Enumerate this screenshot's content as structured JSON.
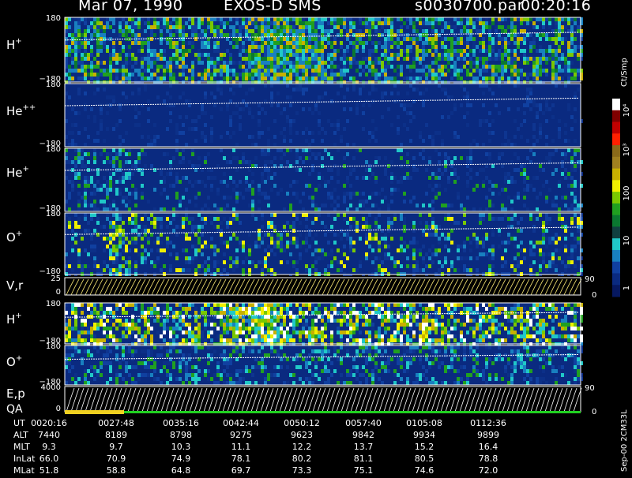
{
  "header": {
    "date": "Mar 07, 1990",
    "instrument": "EXOS-D SMS",
    "file": "s0030700.par",
    "time": "00:20:16"
  },
  "side_labels": {
    "units": "Ct/Smp",
    "version": "Sep-00 2CM33L"
  },
  "panels": [
    {
      "id": "h-plus-1",
      "label": "H",
      "sup": "+",
      "ticks": [
        "180",
        "−180"
      ],
      "colorscale": "h1"
    },
    {
      "id": "he-plus-plus",
      "label": "He",
      "sup": "++",
      "ticks": [
        "180",
        "−180"
      ],
      "colorscale": "hepp"
    },
    {
      "id": "he-plus",
      "label": "He",
      "sup": "+",
      "ticks": [
        "180",
        "−180"
      ],
      "colorscale": "hep"
    },
    {
      "id": "o-plus-1",
      "label": "O",
      "sup": "+",
      "ticks": [
        "180",
        "−180"
      ],
      "colorscale": "o1"
    },
    {
      "id": "vr",
      "label": "V,r",
      "sup": "",
      "ticks": [
        "25",
        "0"
      ],
      "right_ticks": [
        "90",
        "0"
      ]
    },
    {
      "id": "h-plus-2",
      "label": "H",
      "sup": "+",
      "ticks": [
        "180",
        "−180"
      ],
      "colorscale": "h2"
    },
    {
      "id": "o-plus-2",
      "label": "O",
      "sup": "+",
      "ticks": [
        "180",
        "−180"
      ],
      "colorscale": "o2"
    },
    {
      "id": "ep",
      "label": "E,p",
      "sup": "",
      "ticks": [
        "4000",
        "0"
      ],
      "right_ticks": [
        "90",
        "0"
      ],
      "sub_label": "QA"
    }
  ],
  "colorbar": {
    "labels": [
      "10⁴",
      "10³",
      "100",
      "10",
      "1"
    ],
    "colors": [
      "#ffffff",
      "#800000",
      "#c00000",
      "#ff2000",
      "#8a6a1a",
      "#a08020",
      "#c8b000",
      "#f0f000",
      "#7ac800",
      "#20a020",
      "#0a7830",
      "#104040",
      "#20c8c8",
      "#1880c0",
      "#1040a0",
      "#0a2a80",
      "#061860"
    ]
  },
  "chart_data": {
    "type": "heatmap",
    "title": "Mar 07, 1990 EXOS-D SMS",
    "x_axis": {
      "UT": [
        "00:20:16",
        "00:27:48",
        "00:35:16",
        "00:42:44",
        "00:50:12",
        "00:57:40",
        "01:05:08",
        "01:12:36"
      ]
    },
    "rows": {
      "UT": [
        "0020:16",
        "0027:48",
        "0035:16",
        "0042:44",
        "0050:12",
        "0057:40",
        "0105:08",
        "0112:36"
      ],
      "ALT": [
        "7440",
        "8189",
        "8798",
        "9275",
        "9623",
        "9842",
        "9934",
        "9899"
      ],
      "MLT": [
        "9.3",
        "9.7",
        "10.3",
        "11.1",
        "12.2",
        "13.7",
        "15.2",
        "16.4"
      ],
      "InLat": [
        "66.0",
        "70.9",
        "74.9",
        "78.1",
        "80.2",
        "81.1",
        "80.5",
        "78.8"
      ],
      "MLat": [
        "51.8",
        "58.8",
        "64.8",
        "69.7",
        "73.3",
        "75.1",
        "74.6",
        "72.0"
      ]
    },
    "colorbar_scale": "log",
    "colorbar_range": [
      1,
      10000
    ],
    "y_ranges": {
      "pitch_angle": [
        -180,
        180
      ],
      "V_r": [
        0,
        25
      ],
      "E_p": [
        0,
        4000
      ],
      "right_axis": [
        0,
        90
      ]
    }
  },
  "bottom_table_labels": [
    "UT",
    "ALT",
    "MLT",
    "InLat",
    "MLat"
  ]
}
